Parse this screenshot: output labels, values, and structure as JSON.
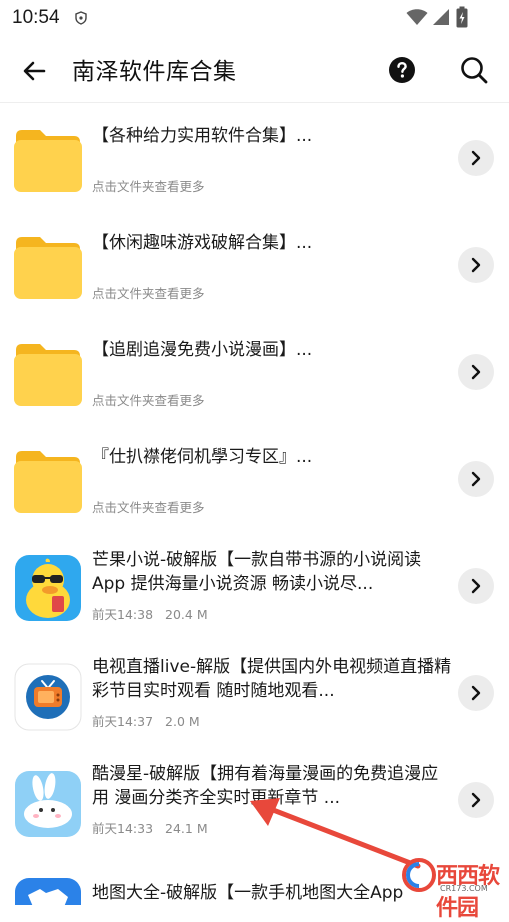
{
  "status_bar": {
    "time": "10:54",
    "icons": [
      "shield-icon",
      "wifi-icon",
      "signal-icon",
      "battery-icon"
    ]
  },
  "header": {
    "title": "南泽软件库合集",
    "back_icon": "back-arrow-icon",
    "help_icon": "help-icon",
    "search_icon": "search-icon"
  },
  "colors": {
    "folder": "#ffd24d",
    "folder_tab": "#f5b51f",
    "arrow_bg": "#ececec",
    "subtext": "#8a8a8a",
    "annotation": "#e8483b"
  },
  "items": [
    {
      "type": "folder",
      "title": "【各种给力实用软件合集】...",
      "sub": "点击文件夹查看更多"
    },
    {
      "type": "folder",
      "title": "【休闲趣味游戏破解合集】...",
      "sub": "点击文件夹查看更多"
    },
    {
      "type": "folder",
      "title": "【追剧追漫免费小说漫画】...",
      "sub": "点击文件夹查看更多"
    },
    {
      "type": "folder",
      "title": "『仕扒襟佬伺机學习专区』...",
      "sub": "点击文件夹查看更多"
    },
    {
      "type": "app",
      "icon": "duck-sunglasses-icon",
      "title": "芒果小说-破解版【一款自带书源的小说阅读App 提供海量小说资源 畅读小说尽...",
      "time": "前天14:38",
      "size": "20.4 M"
    },
    {
      "type": "app",
      "icon": "tv-icon",
      "title": "电视直播live-解版【提供国内外电视频道直播精彩节目实时观看 随时随地观看...",
      "time": "前天14:37",
      "size": "2.0 M"
    },
    {
      "type": "app",
      "icon": "rabbit-icon",
      "title": "酷漫星-破解版【拥有着海量漫画的免费追漫应用 漫画分类齐全实时更新章节 ...",
      "time": "前天14:33",
      "size": "24.1 M"
    },
    {
      "type": "app",
      "icon": "map-icon",
      "title": "地图大全-破解版【一款手机地图大全App",
      "time": "",
      "size": ""
    }
  ],
  "watermark": {
    "text": "西西软件园",
    "sub": "CR173.COM"
  }
}
